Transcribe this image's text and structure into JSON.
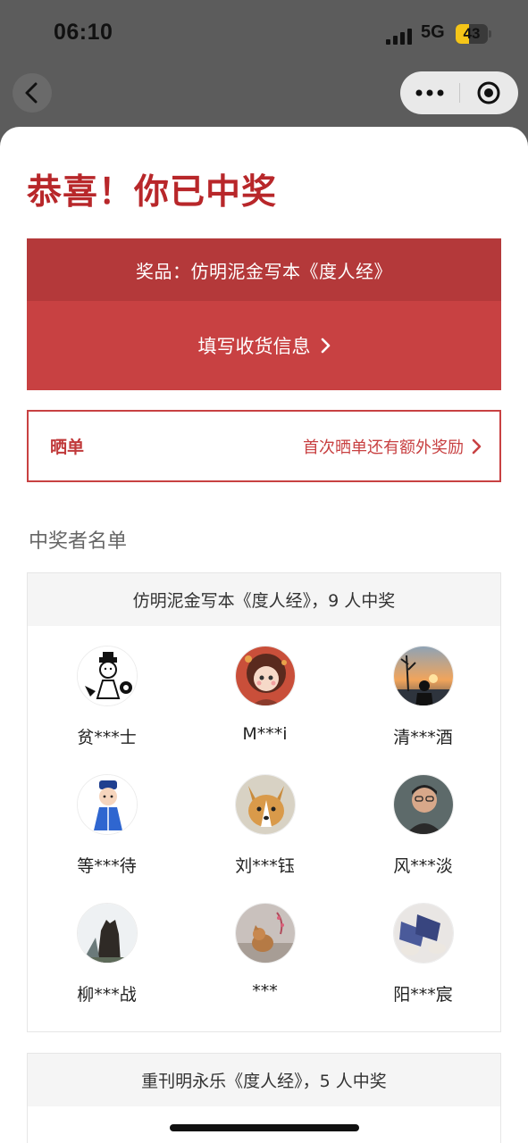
{
  "status_bar": {
    "time": "06:10",
    "network": "5G",
    "battery": "43",
    "battery_level": 0.43
  },
  "nav": {
    "back_icon": "chevron-left-icon",
    "more_icon": "more-dots-icon",
    "close_icon": "target-close-icon"
  },
  "headline": "恭喜！你已中奖",
  "prize": {
    "label": "奖品：仿明泥金写本《度人经》",
    "action": "填写收货信息"
  },
  "share": {
    "label": "晒单",
    "hint": "首次晒单还有额外奖励"
  },
  "winners_title": "中奖者名单",
  "groups": [
    {
      "header": "仿明泥金写本《度人经》，9 人中奖",
      "winners": [
        {
          "name": "贫***士",
          "avatar": "cartoon-scholar"
        },
        {
          "name": "M***i",
          "avatar": "anime-girl"
        },
        {
          "name": "清***酒",
          "avatar": "sunset-silhouette"
        },
        {
          "name": "等***待",
          "avatar": "cartoon-boy-blue"
        },
        {
          "name": "刘***钰",
          "avatar": "corgi-dog"
        },
        {
          "name": "风***淡",
          "avatar": "portrait-man"
        },
        {
          "name": "柳***战",
          "avatar": "stone-statue"
        },
        {
          "name": "***",
          "avatar": "cat-window"
        },
        {
          "name": "阳***宸",
          "avatar": "legs-photo"
        }
      ]
    },
    {
      "header": "重刊明永乐《度人经》，5 人中奖",
      "winners": []
    }
  ],
  "colors": {
    "accent": "#c84142",
    "accent_dark": "#b4393a",
    "headline": "#b8272a"
  }
}
